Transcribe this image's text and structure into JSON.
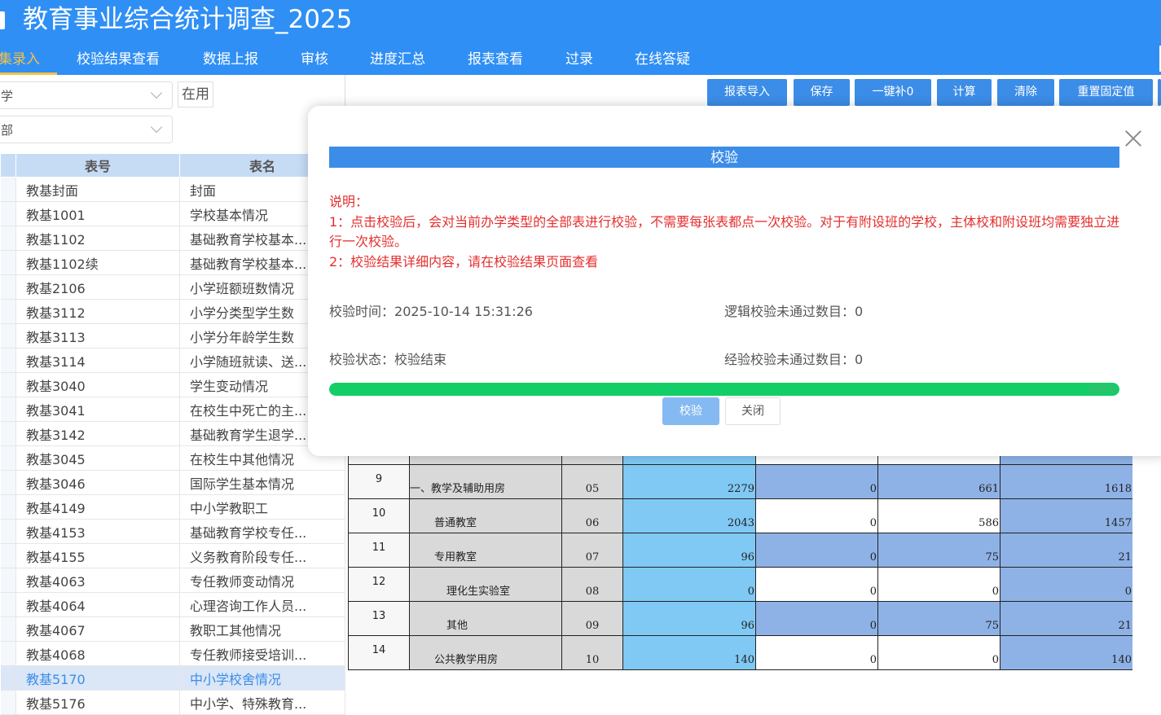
{
  "header": {
    "title": "教育事业综合统计调查_2025",
    "nav": [
      {
        "label": "集录入",
        "active": true
      },
      {
        "label": "校验结果查看"
      },
      {
        "label": "数据上报"
      },
      {
        "label": "审核"
      },
      {
        "label": "进度汇总"
      },
      {
        "label": "报表查看"
      },
      {
        "label": "过录"
      },
      {
        "label": "在线答疑"
      }
    ]
  },
  "left": {
    "select1": "学",
    "select2": "部",
    "status_tag": "在用",
    "columns": [
      "表号",
      "表名"
    ],
    "rows": [
      {
        "no": "教基封面",
        "name": "封面"
      },
      {
        "no": "教基1001",
        "name": "学校基本情况"
      },
      {
        "no": "教基1102",
        "name": "基础教育学校基本..."
      },
      {
        "no": "教基1102续",
        "name": "基础教育学校基本..."
      },
      {
        "no": "教基2106",
        "name": "小学班额班数情况"
      },
      {
        "no": "教基3112",
        "name": "小学分类型学生数"
      },
      {
        "no": "教基3113",
        "name": "小学分年龄学生数"
      },
      {
        "no": "教基3114",
        "name": "小学随班就读、送..."
      },
      {
        "no": "教基3040",
        "name": "学生变动情况"
      },
      {
        "no": "教基3041",
        "name": "在校生中死亡的主..."
      },
      {
        "no": "教基3142",
        "name": "基础教育学生退学..."
      },
      {
        "no": "教基3045",
        "name": "在校生中其他情况"
      },
      {
        "no": "教基3046",
        "name": "国际学生基本情况"
      },
      {
        "no": "教基4149",
        "name": "中小学教职工"
      },
      {
        "no": "教基4153",
        "name": "基础教育学校专任..."
      },
      {
        "no": "教基4155",
        "name": "义务教育阶段专任..."
      },
      {
        "no": "教基4063",
        "name": "专任教师变动情况"
      },
      {
        "no": "教基4064",
        "name": "心理咨询工作人员..."
      },
      {
        "no": "教基4067",
        "name": "教职工其他情况"
      },
      {
        "no": "教基4068",
        "name": "专任教师接受培训..."
      },
      {
        "no": "教基5170",
        "name": "中小学校舍情况",
        "selected": true
      },
      {
        "no": "教基5176",
        "name": "中小学、特殊教育..."
      }
    ]
  },
  "toolbar": [
    "报表导入",
    "保存",
    "一键补0",
    "计算",
    "清除",
    "重置固定值"
  ],
  "grid": {
    "rows": [
      {
        "no": "",
        "name": "",
        "code": "",
        "v": [
          "",
          "",
          "",
          ""
        ]
      },
      {
        "no": "9",
        "name": "一、教学及辅助用房",
        "code": "05",
        "v": [
          "2279",
          "0",
          "661",
          "1618"
        ]
      },
      {
        "no": "10",
        "name": "普通教室",
        "code": "06",
        "v": [
          "2043",
          "0",
          "586",
          "1457"
        ]
      },
      {
        "no": "11",
        "name": "专用教室",
        "code": "07",
        "v": [
          "96",
          "0",
          "75",
          "21"
        ]
      },
      {
        "no": "12",
        "name": "理化生实验室",
        "code": "08",
        "v": [
          "0",
          "0",
          "0",
          "0"
        ]
      },
      {
        "no": "13",
        "name": "其他",
        "code": "09",
        "v": [
          "96",
          "0",
          "75",
          "21"
        ]
      },
      {
        "no": "14",
        "name": "公共教学用房",
        "code": "10",
        "v": [
          "140",
          "0",
          "0",
          "140"
        ]
      }
    ]
  },
  "dialog": {
    "title": "校验",
    "notes": [
      "说明：",
      "1：点击校验后，会对当前办学类型的全部表进行校验，不需要每张表都点一次校验。对于有附设班的学校，主体校和附设班均需要独立进行一次校验。",
      "2：校验结果详细内容，请在校验结果页面查看"
    ],
    "time_label": "校验时间：",
    "time_value": "2025-10-14 15:31:26",
    "logic_label": "逻辑校验未通过数目：",
    "logic_value": "0",
    "state_label": "校验状态：",
    "state_value": "校验结束",
    "exp_label": "经验校验未通过数目：",
    "exp_value": "0",
    "progress": 100,
    "progress_text": "100%",
    "btn_verify": "校验",
    "btn_close": "关闭"
  }
}
